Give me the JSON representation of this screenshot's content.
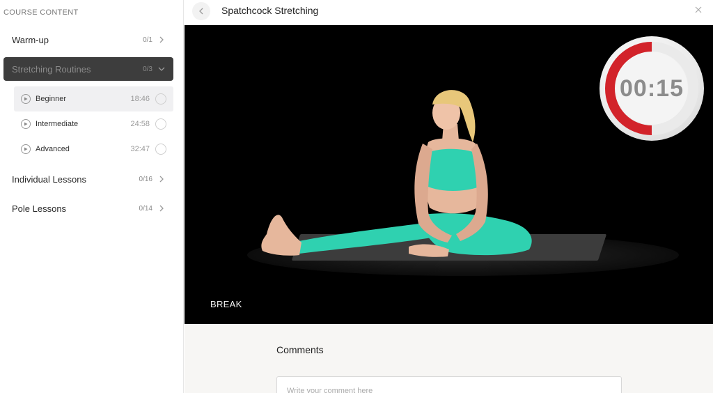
{
  "sidebar": {
    "heading": "COURSE CONTENT",
    "sections": [
      {
        "label": "Warm-up",
        "count": "0/1",
        "chevron": "chevron-right-icon"
      },
      {
        "label": "Stretching Routines",
        "count": "0/3",
        "chevron": "chevron-down-icon",
        "active": true
      },
      {
        "label": "Individual Lessons",
        "count": "0/16",
        "chevron": "chevron-right-icon"
      },
      {
        "label": "Pole Lessons",
        "count": "0/14",
        "chevron": "chevron-right-icon"
      }
    ],
    "lessons": [
      {
        "label": "Beginner",
        "duration": "18:46",
        "current": true
      },
      {
        "label": "Intermediate",
        "duration": "24:58"
      },
      {
        "label": "Advanced",
        "duration": "32:47"
      }
    ]
  },
  "header": {
    "title": "Spatchcock Stretching",
    "back_icon": "chevron-left-icon",
    "close_icon": "close-icon"
  },
  "video": {
    "overlay_text": "BREAK",
    "timer": {
      "display": "00:15",
      "ring_fill_fraction": 0.5,
      "ring_color": "#d2232a"
    }
  },
  "comments": {
    "heading": "Comments",
    "placeholder": "Write your comment here"
  },
  "colors": {
    "active_section_bg": "#3d3d3d",
    "current_lesson_bg": "#f0f0f2",
    "video_bg": "#000000",
    "outfit": "#2fd1b0"
  }
}
